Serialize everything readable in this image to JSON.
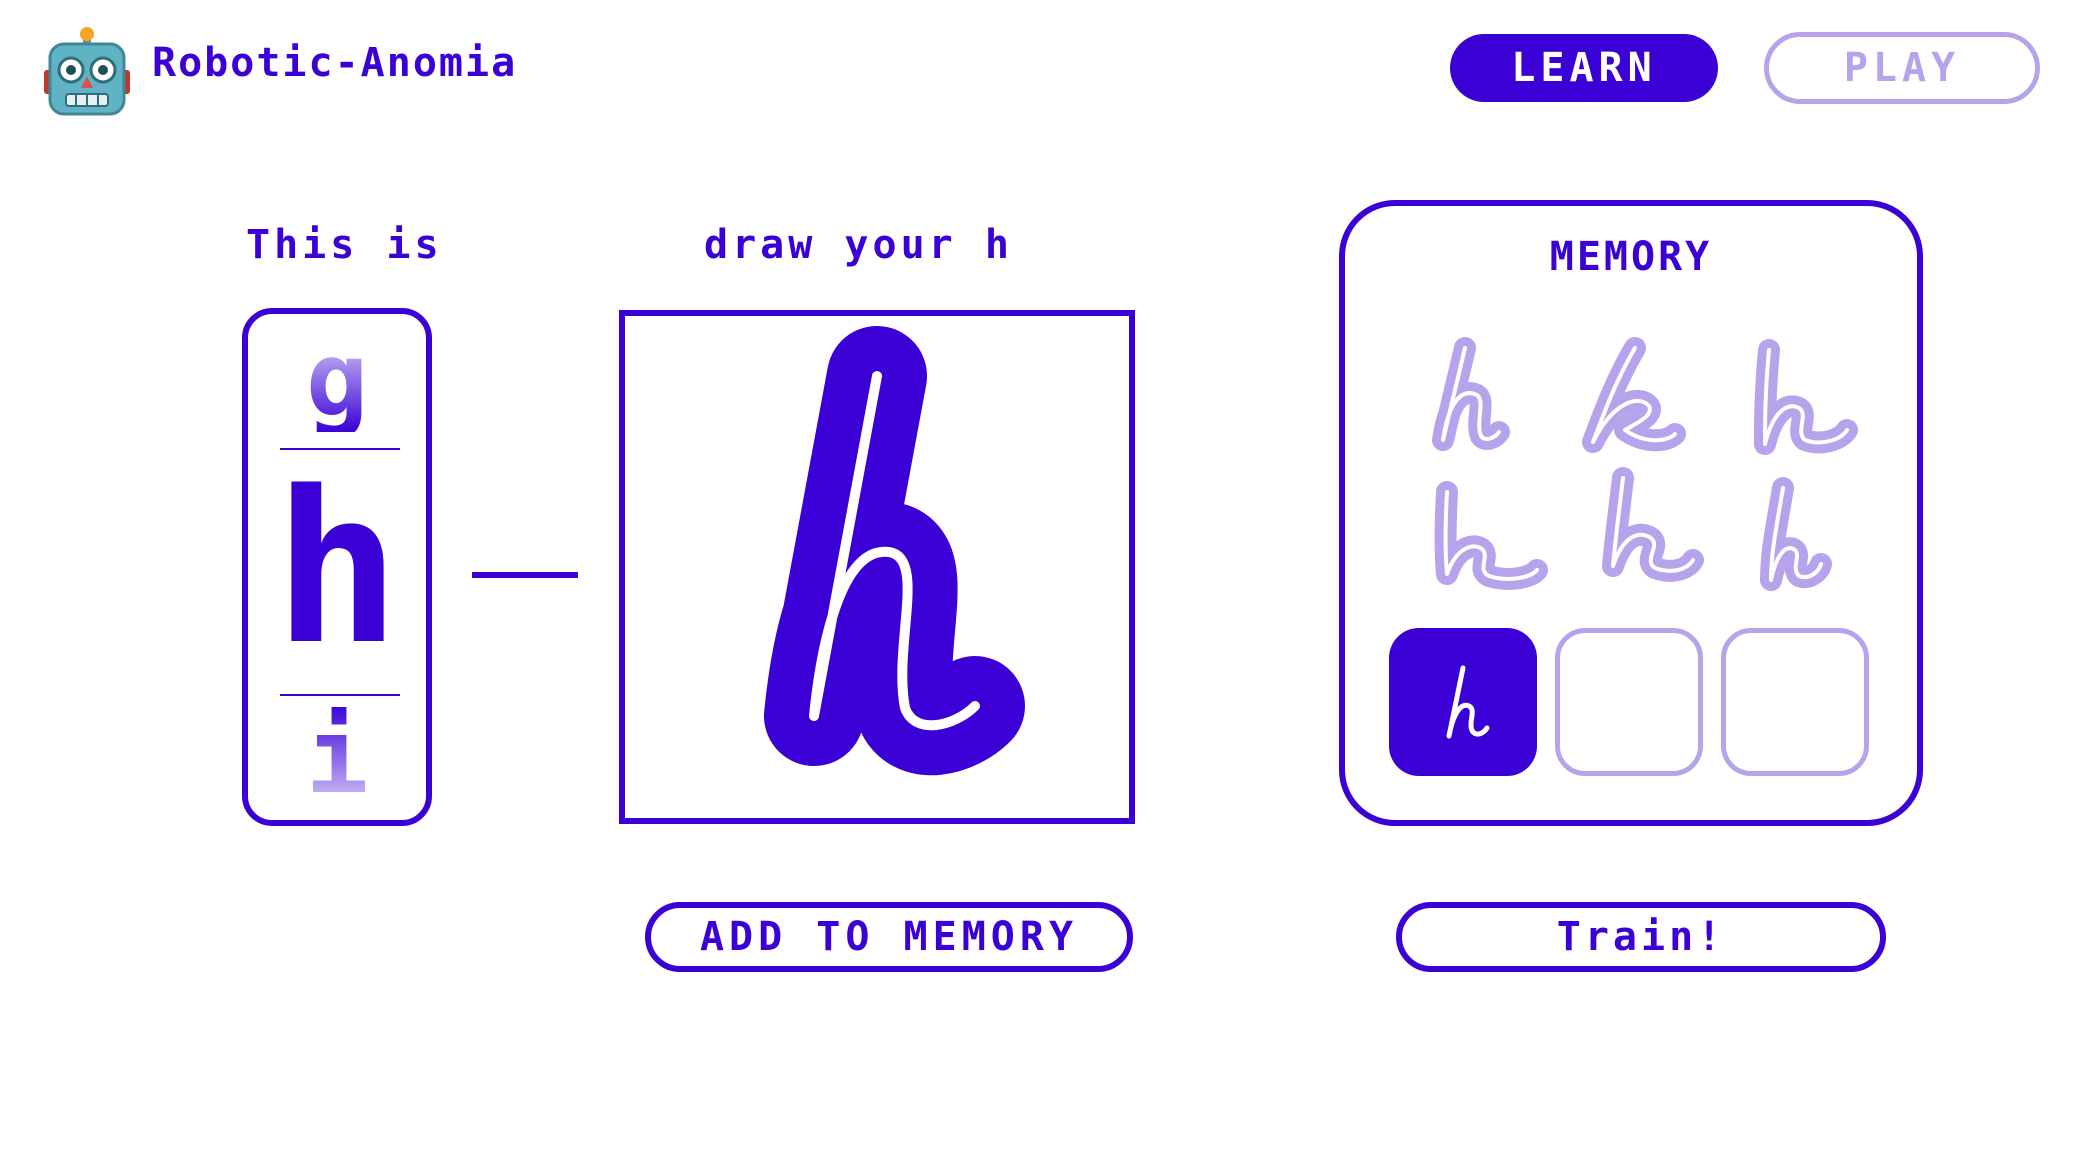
{
  "app": {
    "title": "Robotic-Anomia",
    "logo_icon": "robot-face-icon"
  },
  "nav": {
    "learn_label": "LEARN",
    "play_label": "PLAY",
    "active": "LEARN"
  },
  "letter_panel": {
    "label": "This is",
    "previous_letter": "g",
    "current_letter": "h",
    "next_letter": "i"
  },
  "draw_panel": {
    "label": "draw your h"
  },
  "memory": {
    "title": "MEMORY",
    "samples_count": 6,
    "slots_filled": 1,
    "slots_empty": 2
  },
  "buttons": {
    "add_to_memory": "ADD TO MEMORY",
    "train": "Train!"
  },
  "colors": {
    "accent": "#3a00d6",
    "accent_light": "#b7a3ec",
    "background": "#ffffff"
  }
}
